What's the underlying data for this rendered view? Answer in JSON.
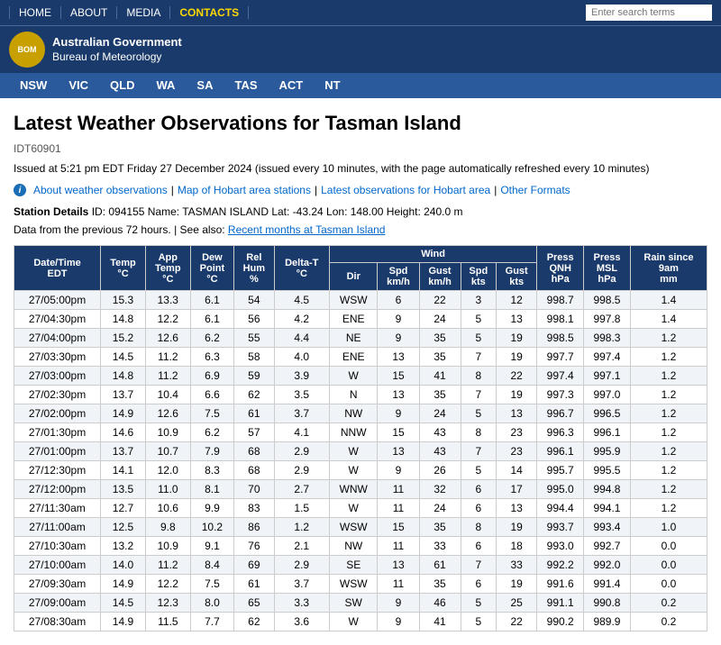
{
  "topnav": {
    "links": [
      {
        "label": "HOME",
        "active": false
      },
      {
        "label": "ABOUT",
        "active": false
      },
      {
        "label": "MEDIA",
        "active": false
      },
      {
        "label": "CONTACTS",
        "active": true
      }
    ],
    "search_placeholder": "Enter search terms"
  },
  "logobar": {
    "line1": "Australian Government",
    "line2": "Bureau of Meteorology"
  },
  "statenav": {
    "states": [
      "NSW",
      "VIC",
      "QLD",
      "WA",
      "SA",
      "TAS",
      "ACT",
      "NT"
    ]
  },
  "main": {
    "title": "Latest Weather Observations for Tasman Island",
    "station_id": "IDT60901",
    "issued": "Issued at 5:21 pm EDT Friday 27 December 2024 (issued every 10 minutes, with the page automatically refreshed every 10 minutes)",
    "links": [
      {
        "label": "About weather observations"
      },
      {
        "label": "Map of Hobart area stations"
      },
      {
        "label": "Latest observations for Hobart area"
      },
      {
        "label": "Other Formats"
      }
    ],
    "station_details_label": "Station Details",
    "station_details": "ID: 094155  Name: TASMAN ISLAND  Lat: -43.24  Lon: 148.00  Height: 240.0 m",
    "data_note_text": "Data from the previous 72 hours. | See also:",
    "data_note_link": "Recent months at Tasman Island",
    "table": {
      "headers": [
        {
          "label": "Date/Time\nEDT",
          "colspan": 1,
          "rowspan": 2
        },
        {
          "label": "Temp\n°C",
          "colspan": 1,
          "rowspan": 2
        },
        {
          "label": "App\nTemp\n°C",
          "colspan": 1,
          "rowspan": 2
        },
        {
          "label": "Dew\nPoint\n°C",
          "colspan": 1,
          "rowspan": 2
        },
        {
          "label": "Rel\nHum\n%",
          "colspan": 1,
          "rowspan": 2
        },
        {
          "label": "Delta-T\n°C",
          "colspan": 1,
          "rowspan": 2
        },
        {
          "label": "Wind",
          "colspan": 4,
          "rowspan": 1
        },
        {
          "label": "Press\nQNH\nhPa",
          "colspan": 1,
          "rowspan": 2
        },
        {
          "label": "Press\nMSL\nhPa",
          "colspan": 1,
          "rowspan": 2
        },
        {
          "label": "Rain since\n9am\nmm",
          "colspan": 1,
          "rowspan": 2
        }
      ],
      "wind_subheaders": [
        "Dir",
        "Spd\nkm/h",
        "Gust\nkm/h",
        "Spd\nkts",
        "Gust\nkts"
      ],
      "rows": [
        [
          "27/05:00pm",
          "15.3",
          "13.3",
          "6.1",
          "54",
          "4.5",
          "WSW",
          "6",
          "22",
          "3",
          "12",
          "998.7",
          "998.5",
          "1.4"
        ],
        [
          "27/04:30pm",
          "14.8",
          "12.2",
          "6.1",
          "56",
          "4.2",
          "ENE",
          "9",
          "24",
          "5",
          "13",
          "998.1",
          "997.8",
          "1.4"
        ],
        [
          "27/04:00pm",
          "15.2",
          "12.6",
          "6.2",
          "55",
          "4.4",
          "NE",
          "9",
          "35",
          "5",
          "19",
          "998.5",
          "998.3",
          "1.2"
        ],
        [
          "27/03:30pm",
          "14.5",
          "11.2",
          "6.3",
          "58",
          "4.0",
          "ENE",
          "13",
          "35",
          "7",
          "19",
          "997.7",
          "997.4",
          "1.2"
        ],
        [
          "27/03:00pm",
          "14.8",
          "11.2",
          "6.9",
          "59",
          "3.9",
          "W",
          "15",
          "41",
          "8",
          "22",
          "997.4",
          "997.1",
          "1.2"
        ],
        [
          "27/02:30pm",
          "13.7",
          "10.4",
          "6.6",
          "62",
          "3.5",
          "N",
          "13",
          "35",
          "7",
          "19",
          "997.3",
          "997.0",
          "1.2"
        ],
        [
          "27/02:00pm",
          "14.9",
          "12.6",
          "7.5",
          "61",
          "3.7",
          "NW",
          "9",
          "24",
          "5",
          "13",
          "996.7",
          "996.5",
          "1.2"
        ],
        [
          "27/01:30pm",
          "14.6",
          "10.9",
          "6.2",
          "57",
          "4.1",
          "NNW",
          "15",
          "43",
          "8",
          "23",
          "996.3",
          "996.1",
          "1.2"
        ],
        [
          "27/01:00pm",
          "13.7",
          "10.7",
          "7.9",
          "68",
          "2.9",
          "W",
          "13",
          "43",
          "7",
          "23",
          "996.1",
          "995.9",
          "1.2"
        ],
        [
          "27/12:30pm",
          "14.1",
          "12.0",
          "8.3",
          "68",
          "2.9",
          "W",
          "9",
          "26",
          "5",
          "14",
          "995.7",
          "995.5",
          "1.2"
        ],
        [
          "27/12:00pm",
          "13.5",
          "11.0",
          "8.1",
          "70",
          "2.7",
          "WNW",
          "11",
          "32",
          "6",
          "17",
          "995.0",
          "994.8",
          "1.2"
        ],
        [
          "27/11:30am",
          "12.7",
          "10.6",
          "9.9",
          "83",
          "1.5",
          "W",
          "11",
          "24",
          "6",
          "13",
          "994.4",
          "994.1",
          "1.2"
        ],
        [
          "27/11:00am",
          "12.5",
          "9.8",
          "10.2",
          "86",
          "1.2",
          "WSW",
          "15",
          "35",
          "8",
          "19",
          "993.7",
          "993.4",
          "1.0"
        ],
        [
          "27/10:30am",
          "13.2",
          "10.9",
          "9.1",
          "76",
          "2.1",
          "NW",
          "11",
          "33",
          "6",
          "18",
          "993.0",
          "992.7",
          "0.0"
        ],
        [
          "27/10:00am",
          "14.0",
          "11.2",
          "8.4",
          "69",
          "2.9",
          "SE",
          "13",
          "61",
          "7",
          "33",
          "992.2",
          "992.0",
          "0.0"
        ],
        [
          "27/09:30am",
          "14.9",
          "12.2",
          "7.5",
          "61",
          "3.7",
          "WSW",
          "11",
          "35",
          "6",
          "19",
          "991.6",
          "991.4",
          "0.0"
        ],
        [
          "27/09:00am",
          "14.5",
          "12.3",
          "8.0",
          "65",
          "3.3",
          "SW",
          "9",
          "46",
          "5",
          "25",
          "991.1",
          "990.8",
          "0.2"
        ],
        [
          "27/08:30am",
          "14.9",
          "11.5",
          "7.7",
          "62",
          "3.6",
          "W",
          "9",
          "41",
          "5",
          "22",
          "990.2",
          "989.9",
          "0.2"
        ]
      ]
    }
  }
}
